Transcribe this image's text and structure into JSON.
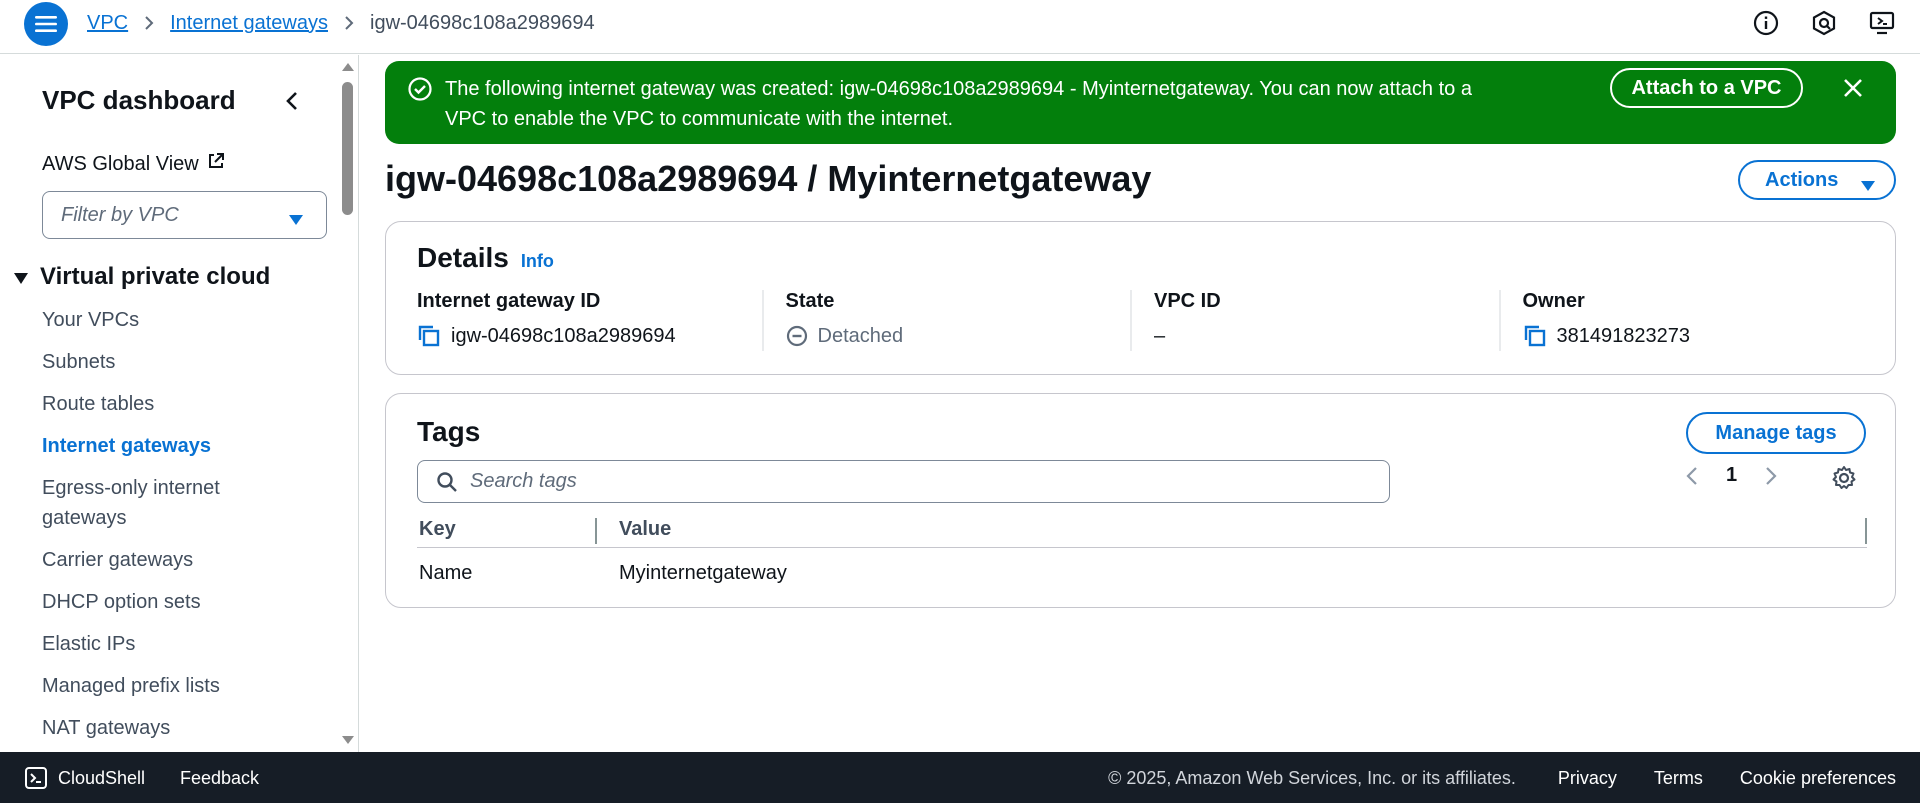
{
  "header": {
    "breadcrumb": [
      {
        "label": "VPC"
      },
      {
        "label": "Internet gateways"
      },
      {
        "label": "igw-04698c108a2989694"
      }
    ],
    "icons": [
      "info-icon",
      "notifications-icon",
      "settings-icon"
    ]
  },
  "sidebar": {
    "title": "VPC dashboard",
    "global_view": "AWS Global View",
    "filter_placeholder": "Filter by VPC",
    "section": "Virtual private cloud",
    "items": [
      {
        "label": "Your VPCs"
      },
      {
        "label": "Subnets"
      },
      {
        "label": "Route tables"
      },
      {
        "label": "Internet gateways",
        "active": true
      },
      {
        "label": "Egress-only internet gateways"
      },
      {
        "label": "Carrier gateways"
      },
      {
        "label": "DHCP option sets"
      },
      {
        "label": "Elastic IPs"
      },
      {
        "label": "Managed prefix lists"
      },
      {
        "label": "NAT gateways"
      }
    ]
  },
  "flash": {
    "message": "The following internet gateway was created: igw-04698c108a2989694 - Myinternetgateway. You can now attach to a VPC to enable the VPC to communicate with the internet.",
    "action_label": "Attach to a VPC",
    "color": "#037f0c"
  },
  "page": {
    "title": "igw-04698c108a2989694 / Myinternetgateway",
    "actions_label": "Actions"
  },
  "details": {
    "title": "Details",
    "info_label": "Info",
    "fields": {
      "gateway_id": {
        "label": "Internet gateway ID",
        "value": "igw-04698c108a2989694"
      },
      "state": {
        "label": "State",
        "value": "Detached"
      },
      "vpc_id": {
        "label": "VPC ID",
        "value": "–"
      },
      "owner": {
        "label": "Owner",
        "value": "381491823273"
      }
    }
  },
  "tags": {
    "title": "Tags",
    "manage_label": "Manage tags",
    "search_placeholder": "Search tags",
    "page": "1",
    "columns": {
      "key": "Key",
      "value": "Value"
    },
    "rows": [
      {
        "key": "Name",
        "value": "Myinternetgateway"
      }
    ]
  },
  "footer": {
    "cloudshell": "CloudShell",
    "feedback": "Feedback",
    "copyright": "© 2025, Amazon Web Services, Inc. or its affiliates.",
    "links": [
      "Privacy",
      "Terms",
      "Cookie preferences"
    ]
  },
  "colors": {
    "accent": "#0972d3",
    "success": "#037f0c",
    "footer_bg": "#161d26"
  }
}
